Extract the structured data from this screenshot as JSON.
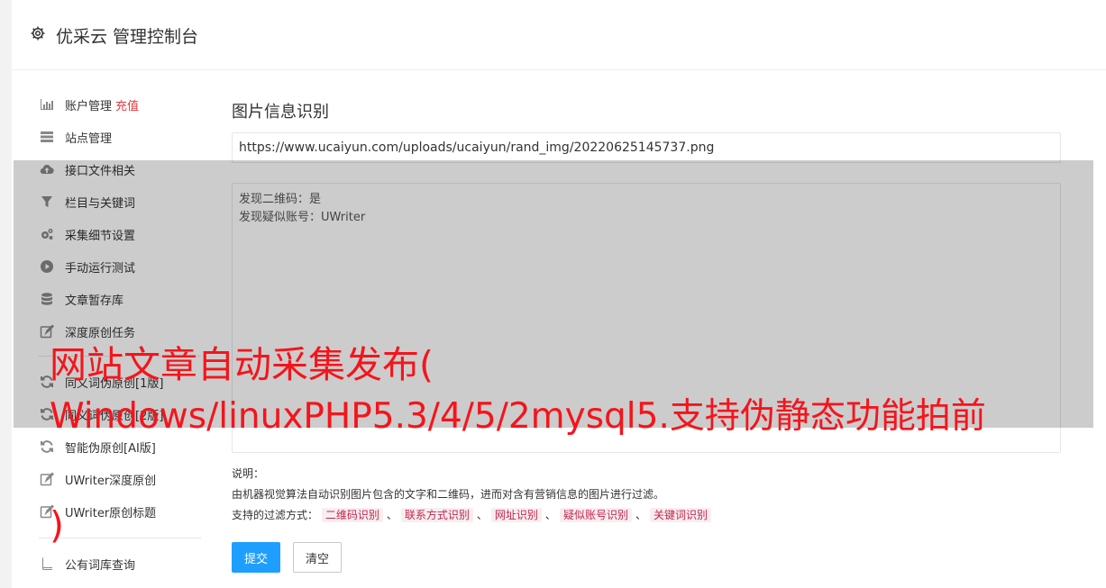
{
  "header": {
    "title": "优采云 管理控制台",
    "icon": "gear-icon"
  },
  "sidebar": {
    "items": [
      {
        "label": "账户管理",
        "badge": "充值",
        "icon": "bar-chart-icon"
      },
      {
        "label": "站点管理",
        "icon": "server-icon"
      },
      {
        "label": "接口文件相关",
        "icon": "cloud-upload-icon"
      },
      {
        "label": "栏目与关键词",
        "icon": "filter-icon"
      },
      {
        "label": "采集细节设置",
        "icon": "gears-icon"
      },
      {
        "label": "手动运行测试",
        "icon": "play-icon"
      },
      {
        "label": "文章暂存库",
        "icon": "database-icon"
      },
      {
        "label": "深度原创任务",
        "icon": "edit-icon"
      },
      {
        "label": "同义词伪原创[1版]",
        "icon": "refresh-icon"
      },
      {
        "label": "同义词伪原创[2版]",
        "icon": "refresh-icon"
      },
      {
        "label": "智能伪原创[AI版]",
        "icon": "refresh-icon"
      },
      {
        "label": "UWriter深度原创",
        "icon": "edit-icon"
      },
      {
        "label": "UWriter原创标题",
        "icon": "edit-icon"
      },
      {
        "label": "公有词库查询",
        "icon": "book-icon"
      }
    ]
  },
  "main": {
    "section_title": "图片信息识别",
    "url_value": "https://www.ucaiyun.com/uploads/ucaiyun/rand_img/20220625145737.png",
    "result_lines": [
      "发现二维码：是",
      "发现疑似账号：UWriter"
    ],
    "help_label": "说明：",
    "help_desc": "由机器视觉算法自动识别图片包含的文字和二维码，进而对含有营销信息的图片进行过滤。",
    "filter_prefix": "支持的过滤方式：",
    "filter_tags": [
      "二维码识别",
      "联系方式识别",
      "网址识别",
      "疑似账号识别",
      "关键词识别"
    ],
    "filter_sep": "、",
    "submit_label": "提交",
    "clear_label": "清空"
  },
  "overlay_text": {
    "line1": "网站文章自动采集发布(",
    "line2": "Windows/linuxPHP5.3/4/5/2mysql5.支持伪静态功能拍前",
    "line3": ")"
  },
  "colors": {
    "accent": "#1e9fff",
    "banner": "#f5141b",
    "badge": "#e4393c"
  }
}
